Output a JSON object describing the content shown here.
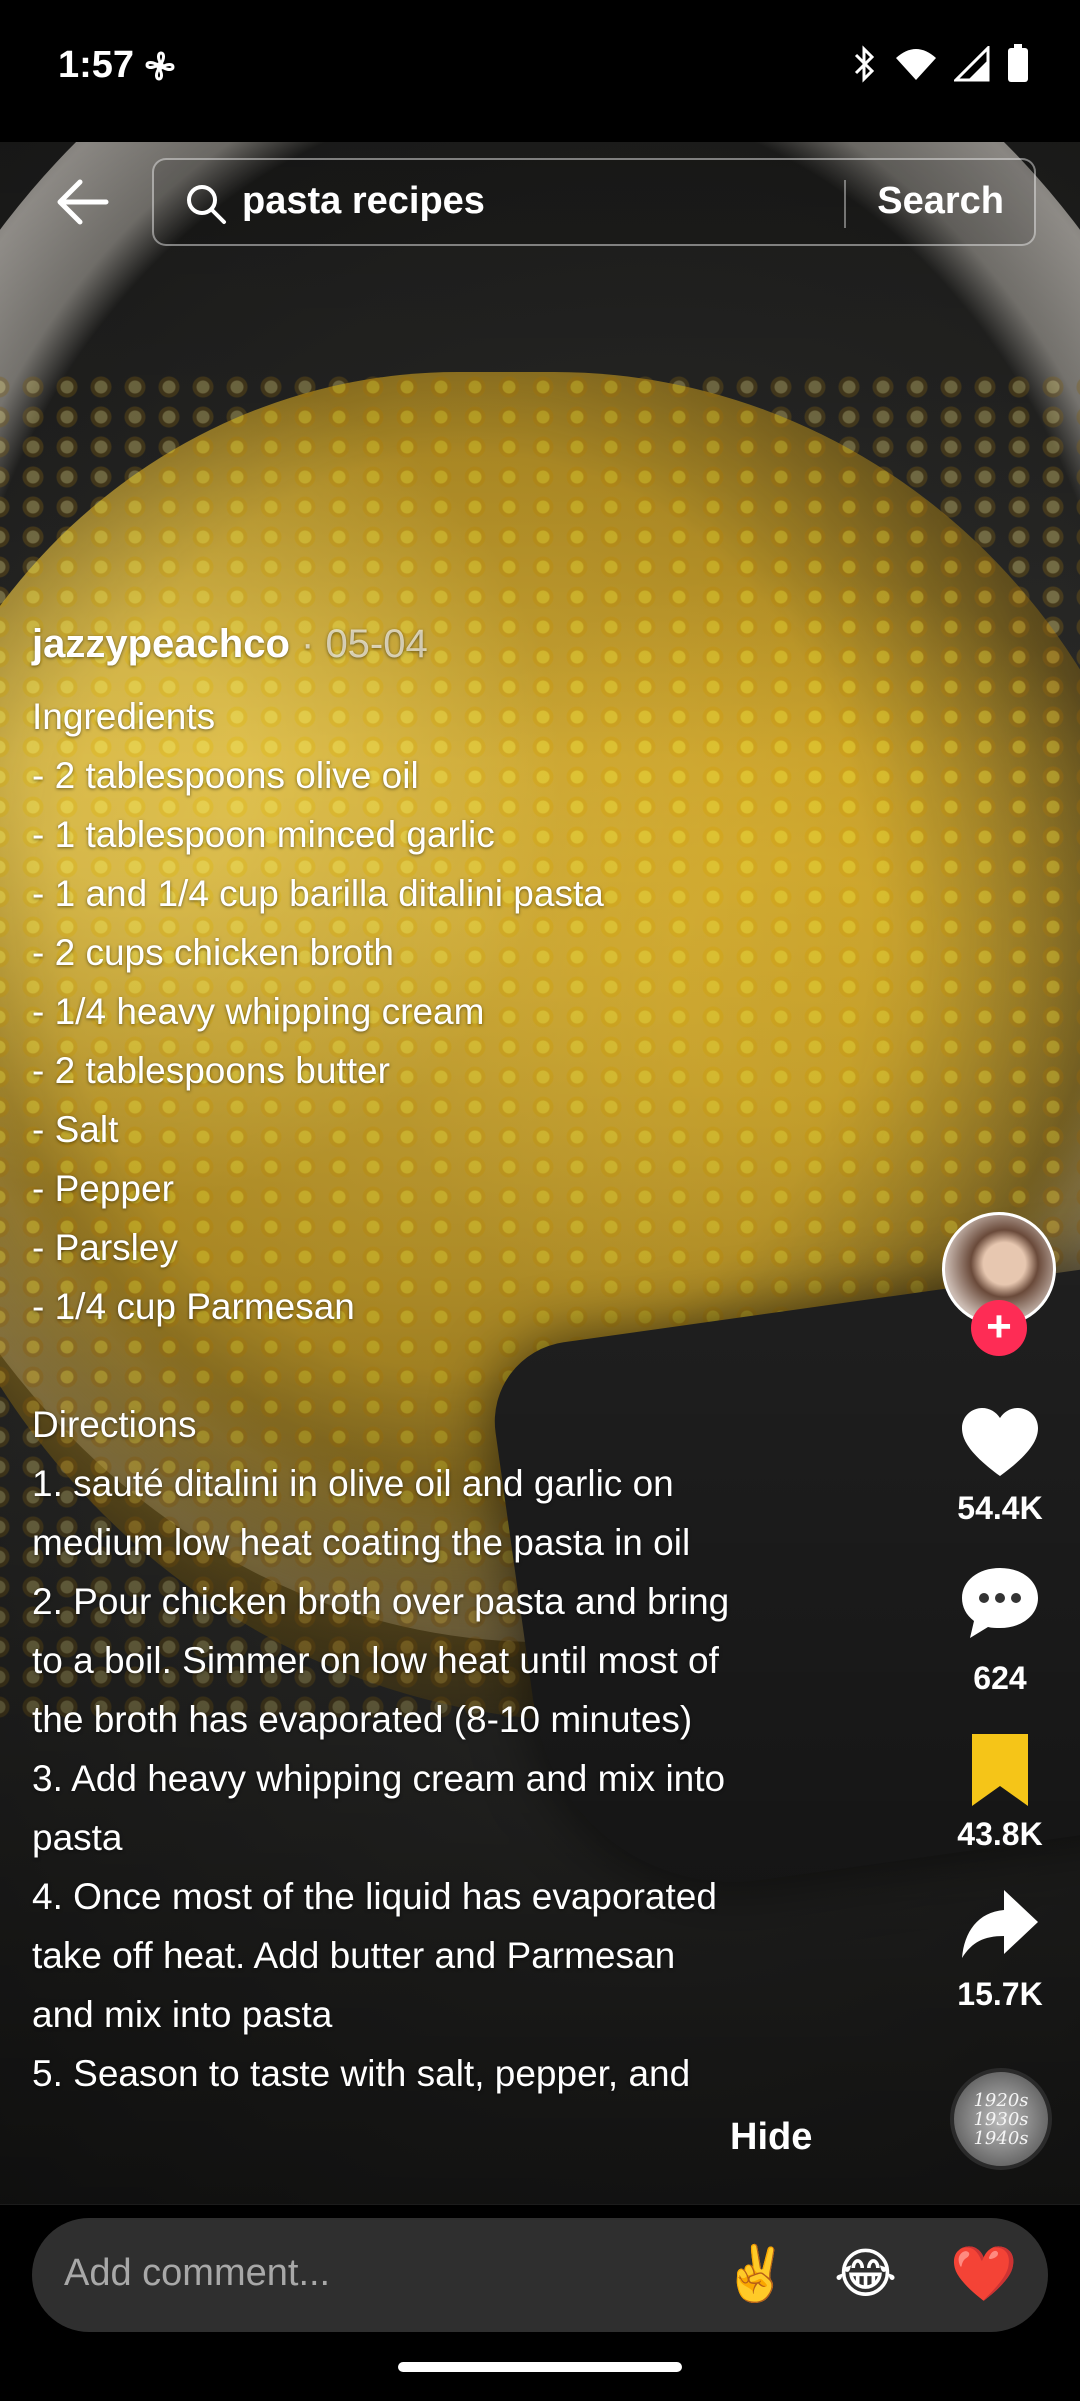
{
  "status_bar": {
    "time": "1:57",
    "icons": [
      "fan-icon",
      "bluetooth-icon",
      "wifi-icon",
      "signal-icon",
      "battery-icon"
    ]
  },
  "search": {
    "query": "pasta recipes",
    "button_label": "Search"
  },
  "post": {
    "author": "jazzypeachco",
    "separator": " · ",
    "date": "05-04",
    "description_lines": [
      "Ingredients",
      "- 2 tablespoons olive oil",
      "- 1 tablespoon minced garlic",
      "- 1 and 1/4 cup barilla ditalini pasta",
      "- 2 cups chicken broth",
      "- 1/4 heavy whipping cream",
      "- 2 tablespoons butter",
      "- Salt",
      "- Pepper",
      "- Parsley",
      "- 1/4 cup Parmesan",
      "",
      "Directions",
      "1. sauté ditalini in olive oil and garlic on",
      "medium low heat coating the pasta in oil",
      "2. Pour chicken broth over pasta and bring",
      "to a boil. Simmer on low heat until most of",
      "the broth has evaporated (8-10 minutes)",
      "3. Add heavy whipping cream and mix into",
      "pasta",
      "4. Once most of the liquid has evaporated",
      "take off heat. Add butter and Parmesan",
      "and mix into pasta",
      "5. Season to taste with salt, pepper, and"
    ],
    "hide_label": "Hide"
  },
  "actions": {
    "follow_symbol": "+",
    "likes": "54.4K",
    "comments": "624",
    "saves": "43.8K",
    "shares": "15.7K"
  },
  "music_disc": {
    "lines": [
      "1920s",
      "1930s",
      "1940s"
    ]
  },
  "comment_bar": {
    "placeholder": "Add comment...",
    "emojis": [
      "✌️",
      "😂",
      "❤️"
    ]
  },
  "colors": {
    "follow_accent": "#fe2c55",
    "save_icon": "#f5c518",
    "comment_bg": "#2f2f2f"
  }
}
